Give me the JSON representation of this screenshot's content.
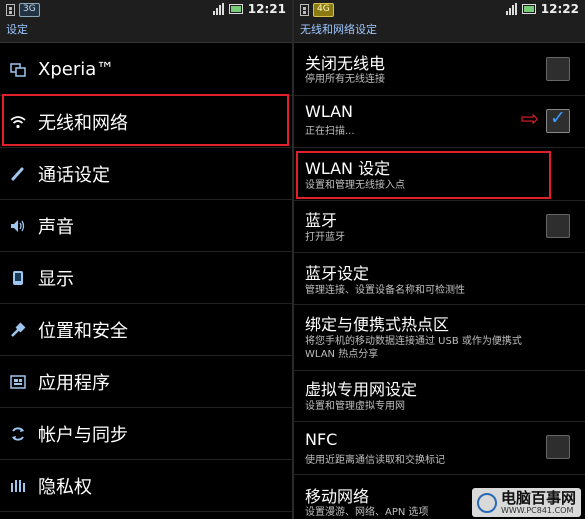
{
  "left": {
    "status": {
      "badge": "3G",
      "time": "12:21"
    },
    "title": "设定",
    "items": [
      {
        "label": "Xperia™",
        "icon": "phone-window-icon"
      },
      {
        "label": "无线和网络",
        "icon": "wifi-icon"
      },
      {
        "label": "通话设定",
        "icon": "handset-icon"
      },
      {
        "label": "声音",
        "icon": "speaker-icon"
      },
      {
        "label": "显示",
        "icon": "display-icon"
      },
      {
        "label": "位置和安全",
        "icon": "location-lock-icon"
      },
      {
        "label": "应用程序",
        "icon": "apps-icon"
      },
      {
        "label": "帐户与同步",
        "icon": "sync-icon"
      },
      {
        "label": "隐私权",
        "icon": "privacy-icon"
      }
    ]
  },
  "right": {
    "status": {
      "badge": "4G",
      "time": "12:22"
    },
    "title": "无线和网络设定",
    "items": [
      {
        "title": "关闭无线电",
        "subtitle": "停用所有无线连接",
        "checkbox": "unchecked"
      },
      {
        "title": "WLAN",
        "subtitle": "正在扫描...",
        "checkbox": "checked"
      },
      {
        "title": "WLAN 设定",
        "subtitle": "设置和管理无线接入点"
      },
      {
        "title": "蓝牙",
        "subtitle": "打开蓝牙",
        "checkbox": "unchecked"
      },
      {
        "title": "蓝牙设定",
        "subtitle": "管理连接、设置设备名称和可检测性"
      },
      {
        "title": "绑定与便携式热点区",
        "subtitle": "将您手机的移动数据连接通过 USB 或作为便携式 WLAN 热点分享"
      },
      {
        "title": "虚拟专用网设定",
        "subtitle": "设置和管理虚拟专用网"
      },
      {
        "title": "NFC",
        "subtitle": "使用近距离通信读取和交换标记",
        "checkbox": "unchecked"
      },
      {
        "title": "移动网络",
        "subtitle": "设置漫游、网络、APN 选项"
      }
    ]
  },
  "watermark": {
    "name": "电脑百事网",
    "site": "WWW.PC841.COM"
  },
  "colors": {
    "highlight": "#e0212a",
    "accent": "#3b9cff",
    "title_text": "#9ec7ff"
  }
}
